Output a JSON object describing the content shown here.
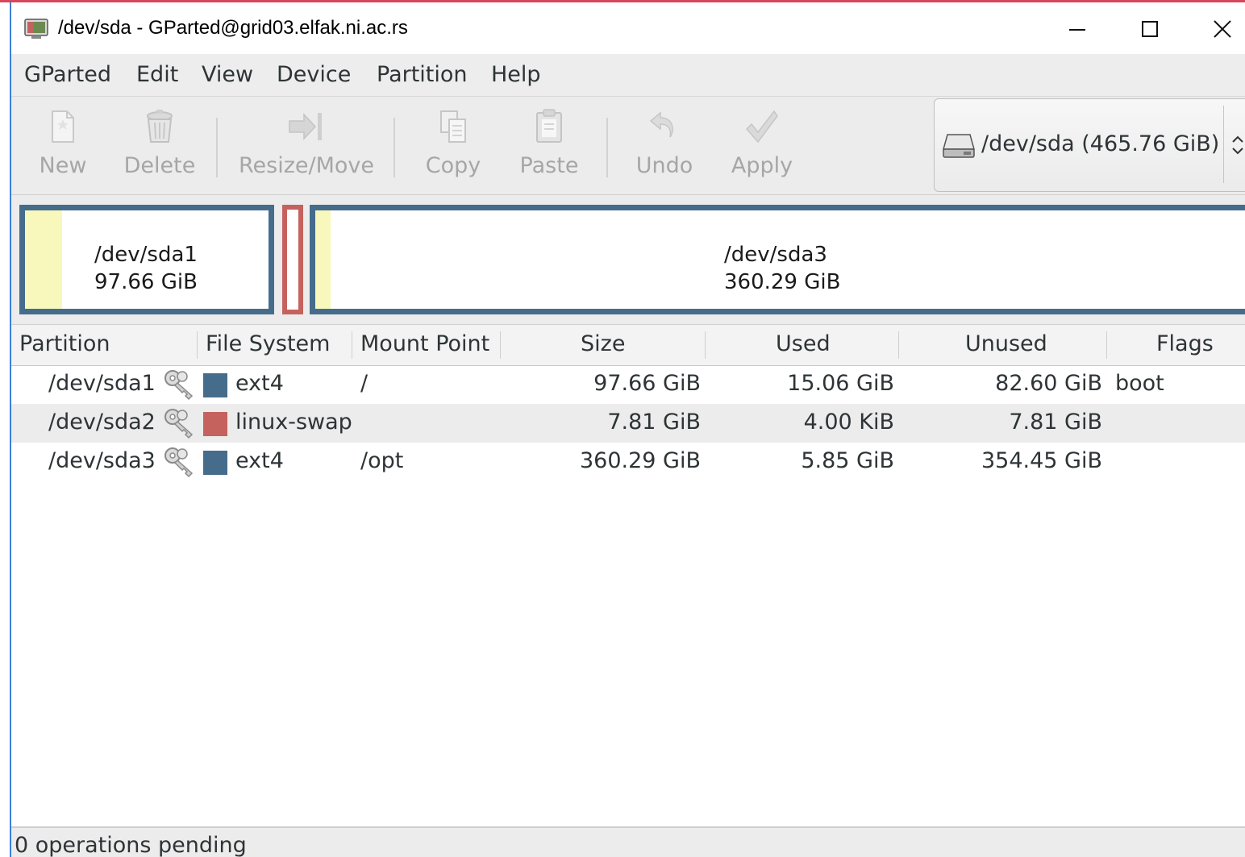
{
  "window": {
    "title": "/dev/sda - GParted@grid03.elfak.ni.ac.rs"
  },
  "menu": [
    "GParted",
    "Edit",
    "View",
    "Device",
    "Partition",
    "Help"
  ],
  "toolbar": {
    "new_label": "New",
    "delete_label": "Delete",
    "resize_label": "Resize/Move",
    "copy_label": "Copy",
    "paste_label": "Paste",
    "undo_label": "Undo",
    "apply_label": "Apply"
  },
  "device": {
    "selected": "/dev/sda  (465.76 GiB)"
  },
  "partition_map": {
    "sda1": {
      "name": "/dev/sda1",
      "size": "97.66 GiB"
    },
    "sda3": {
      "name": "/dev/sda3",
      "size": "360.29 GiB"
    }
  },
  "table": {
    "headers": {
      "partition": "Partition",
      "filesystem": "File System",
      "mountpoint": "Mount Point",
      "size": "Size",
      "used": "Used",
      "unused": "Unused",
      "flags": "Flags"
    },
    "rows": [
      {
        "partition": "/dev/sda1",
        "filesystem": "ext4",
        "fs_color": "#466c8c",
        "mountpoint": "/",
        "size": "97.66 GiB",
        "used": "15.06 GiB",
        "unused": "82.60 GiB",
        "flags": "boot"
      },
      {
        "partition": "/dev/sda2",
        "filesystem": "linux-swap",
        "fs_color": "#c5625e",
        "mountpoint": "",
        "size": "7.81 GiB",
        "used": "4.00 KiB",
        "unused": "7.81 GiB",
        "flags": ""
      },
      {
        "partition": "/dev/sda3",
        "filesystem": "ext4",
        "fs_color": "#466c8c",
        "mountpoint": "/opt",
        "size": "360.29 GiB",
        "used": "5.85 GiB",
        "unused": "354.45 GiB",
        "flags": ""
      }
    ]
  },
  "status": {
    "text": "0 operations pending"
  },
  "colors": {
    "ext4": "#466c8c",
    "linux_swap": "#c5625e",
    "used_fill": "#f8f8bd",
    "alt_row": "#ececec"
  }
}
